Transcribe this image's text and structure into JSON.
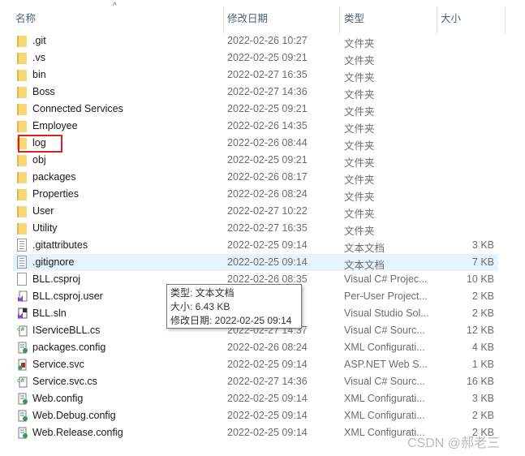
{
  "columns": {
    "name": "名称",
    "date": "修改日期",
    "type": "类型",
    "size": "大小"
  },
  "files": [
    {
      "name": ".git",
      "date": "2022-02-26 10:27",
      "type": "文件夹",
      "size": "",
      "icon": "folder-icon"
    },
    {
      "name": ".vs",
      "date": "2022-02-25 09:21",
      "type": "文件夹",
      "size": "",
      "icon": "folder-icon"
    },
    {
      "name": "bin",
      "date": "2022-02-27 16:35",
      "type": "文件夹",
      "size": "",
      "icon": "folder-icon"
    },
    {
      "name": "Boss",
      "date": "2022-02-27 14:36",
      "type": "文件夹",
      "size": "",
      "icon": "folder-icon"
    },
    {
      "name": "Connected Services",
      "date": "2022-02-25 09:21",
      "type": "文件夹",
      "size": "",
      "icon": "folder-icon"
    },
    {
      "name": "Employee",
      "date": "2022-02-26 14:35",
      "type": "文件夹",
      "size": "",
      "icon": "folder-icon"
    },
    {
      "name": "log",
      "date": "2022-02-26 08:44",
      "type": "文件夹",
      "size": "",
      "icon": "folder-icon"
    },
    {
      "name": "obj",
      "date": "2022-02-25 09:21",
      "type": "文件夹",
      "size": "",
      "icon": "folder-icon"
    },
    {
      "name": "packages",
      "date": "2022-02-26 08:17",
      "type": "文件夹",
      "size": "",
      "icon": "folder-icon"
    },
    {
      "name": "Properties",
      "date": "2022-02-26 08:24",
      "type": "文件夹",
      "size": "",
      "icon": "folder-icon"
    },
    {
      "name": "User",
      "date": "2022-02-27 10:22",
      "type": "文件夹",
      "size": "",
      "icon": "folder-icon"
    },
    {
      "name": "Utility",
      "date": "2022-02-27 16:35",
      "type": "文件夹",
      "size": "",
      "icon": "folder-icon"
    },
    {
      "name": ".gitattributes",
      "date": "2022-02-25 09:14",
      "type": "文本文档",
      "size": "3 KB",
      "icon": "text-file-icon"
    },
    {
      "name": ".gitignore",
      "date": "2022-02-25 09:14",
      "type": "文本文档",
      "size": "7 KB",
      "icon": "text-file-icon"
    },
    {
      "name": "BLL.csproj",
      "date": "2022-02-26 08:35",
      "type": "Visual C# Projec...",
      "size": "10 KB",
      "icon": "blank-file-icon"
    },
    {
      "name": "BLL.csproj.user",
      "date": "7",
      "type": "Per-User Project...",
      "size": "2 KB",
      "icon": "vs-user-file-icon"
    },
    {
      "name": "BLL.sln",
      "date": "4",
      "type": "Visual Studio Sol...",
      "size": "2 KB",
      "icon": "vs-solution-icon"
    },
    {
      "name": "IServiceBLL.cs",
      "date": "2022-02-27 14:37",
      "type": "Visual C# Sourc...",
      "size": "12 KB",
      "icon": "csharp-file-icon"
    },
    {
      "name": "packages.config",
      "date": "2022-02-26 08:24",
      "type": "XML Configurati...",
      "size": "4 KB",
      "icon": "config-file-icon"
    },
    {
      "name": "Service.svc",
      "date": "2022-02-25 09:14",
      "type": "ASP.NET Web S...",
      "size": "1 KB",
      "icon": "svc-file-icon"
    },
    {
      "name": "Service.svc.cs",
      "date": "2022-02-27 14:36",
      "type": "Visual C# Sourc...",
      "size": "16 KB",
      "icon": "csharp-file-icon"
    },
    {
      "name": "Web.config",
      "date": "2022-02-25 09:14",
      "type": "XML Configurati...",
      "size": "3 KB",
      "icon": "config-file-icon"
    },
    {
      "name": "Web.Debug.config",
      "date": "2022-02-25 09:14",
      "type": "XML Configurati...",
      "size": "2 KB",
      "icon": "config-file-icon"
    },
    {
      "name": "Web.Release.config",
      "date": "2022-02-25 09:14",
      "type": "XML Configurati...",
      "size": "2 KB",
      "icon": "config-file-icon"
    }
  ],
  "hovered_file": ".gitignore",
  "highlighted_file": "log",
  "tooltip": {
    "type": "类型: 文本文档",
    "size": "大小: 6.43 KB",
    "date": "修改日期: 2022-02-25 09:14"
  },
  "watermark": "CSDN @郝老三",
  "colors": {
    "hover": "#e5f3ff",
    "highlight_box": "#e02020",
    "folder": "#f8d775"
  }
}
